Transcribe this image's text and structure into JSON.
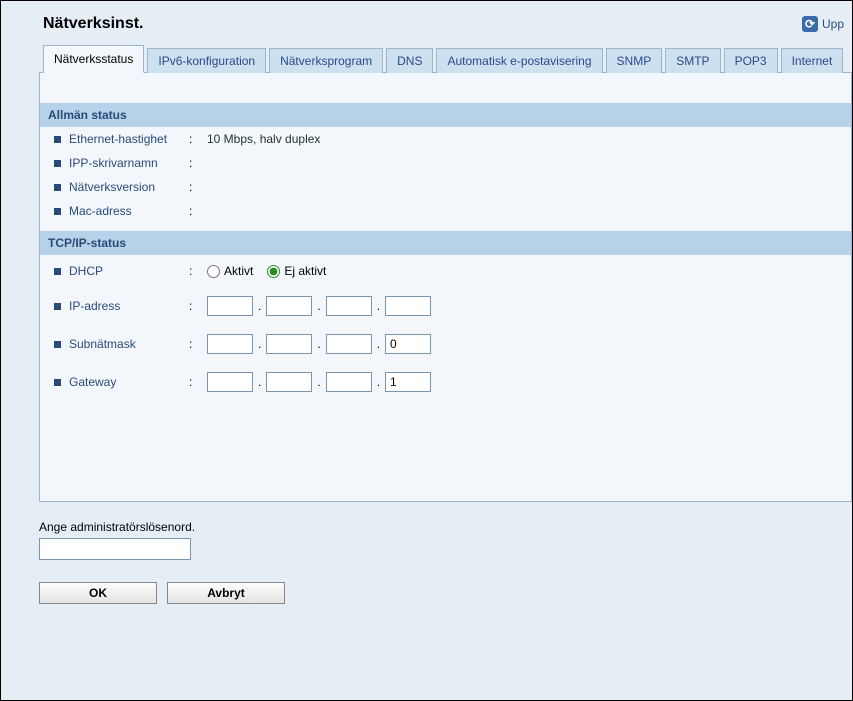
{
  "header": {
    "title": "Nätverksinst.",
    "refresh_label": "Upp"
  },
  "tabs": [
    {
      "label": "Nätverksstatus",
      "active": true
    },
    {
      "label": "IPv6-konfiguration",
      "active": false
    },
    {
      "label": "Nätverksprogram",
      "active": false
    },
    {
      "label": "DNS",
      "active": false
    },
    {
      "label": "Automatisk e-postavisering",
      "active": false
    },
    {
      "label": "SNMP",
      "active": false
    },
    {
      "label": "SMTP",
      "active": false
    },
    {
      "label": "POP3",
      "active": false
    },
    {
      "label": "Internet",
      "active": false
    }
  ],
  "sections": {
    "general": {
      "title": "Allmän status",
      "fields": {
        "ethernet_speed_label": "Ethernet-hastighet",
        "ethernet_speed_value": "10 Mbps, halv duplex",
        "ipp_name_label": "IPP-skrivarnamn",
        "ipp_name_value": "",
        "net_version_label": "Nätverksversion",
        "net_version_value": "",
        "mac_label": "Mac-adress",
        "mac_value": ""
      }
    },
    "tcpip": {
      "title": "TCP/IP-status",
      "dhcp_label": "DHCP",
      "dhcp_active_label": "Aktivt",
      "dhcp_inactive_label": "Ej aktivt",
      "dhcp_value": "inactive",
      "ip_label": "IP-adress",
      "ip": [
        "",
        "",
        "",
        ""
      ],
      "subnet_label": "Subnätmask",
      "subnet": [
        "",
        "",
        "",
        "0"
      ],
      "gateway_label": "Gateway",
      "gateway": [
        "",
        "",
        "",
        "1"
      ]
    }
  },
  "footer": {
    "admin_label": "Ange administratörslösenord.",
    "admin_value": "",
    "ok_label": "OK",
    "cancel_label": "Avbryt"
  }
}
